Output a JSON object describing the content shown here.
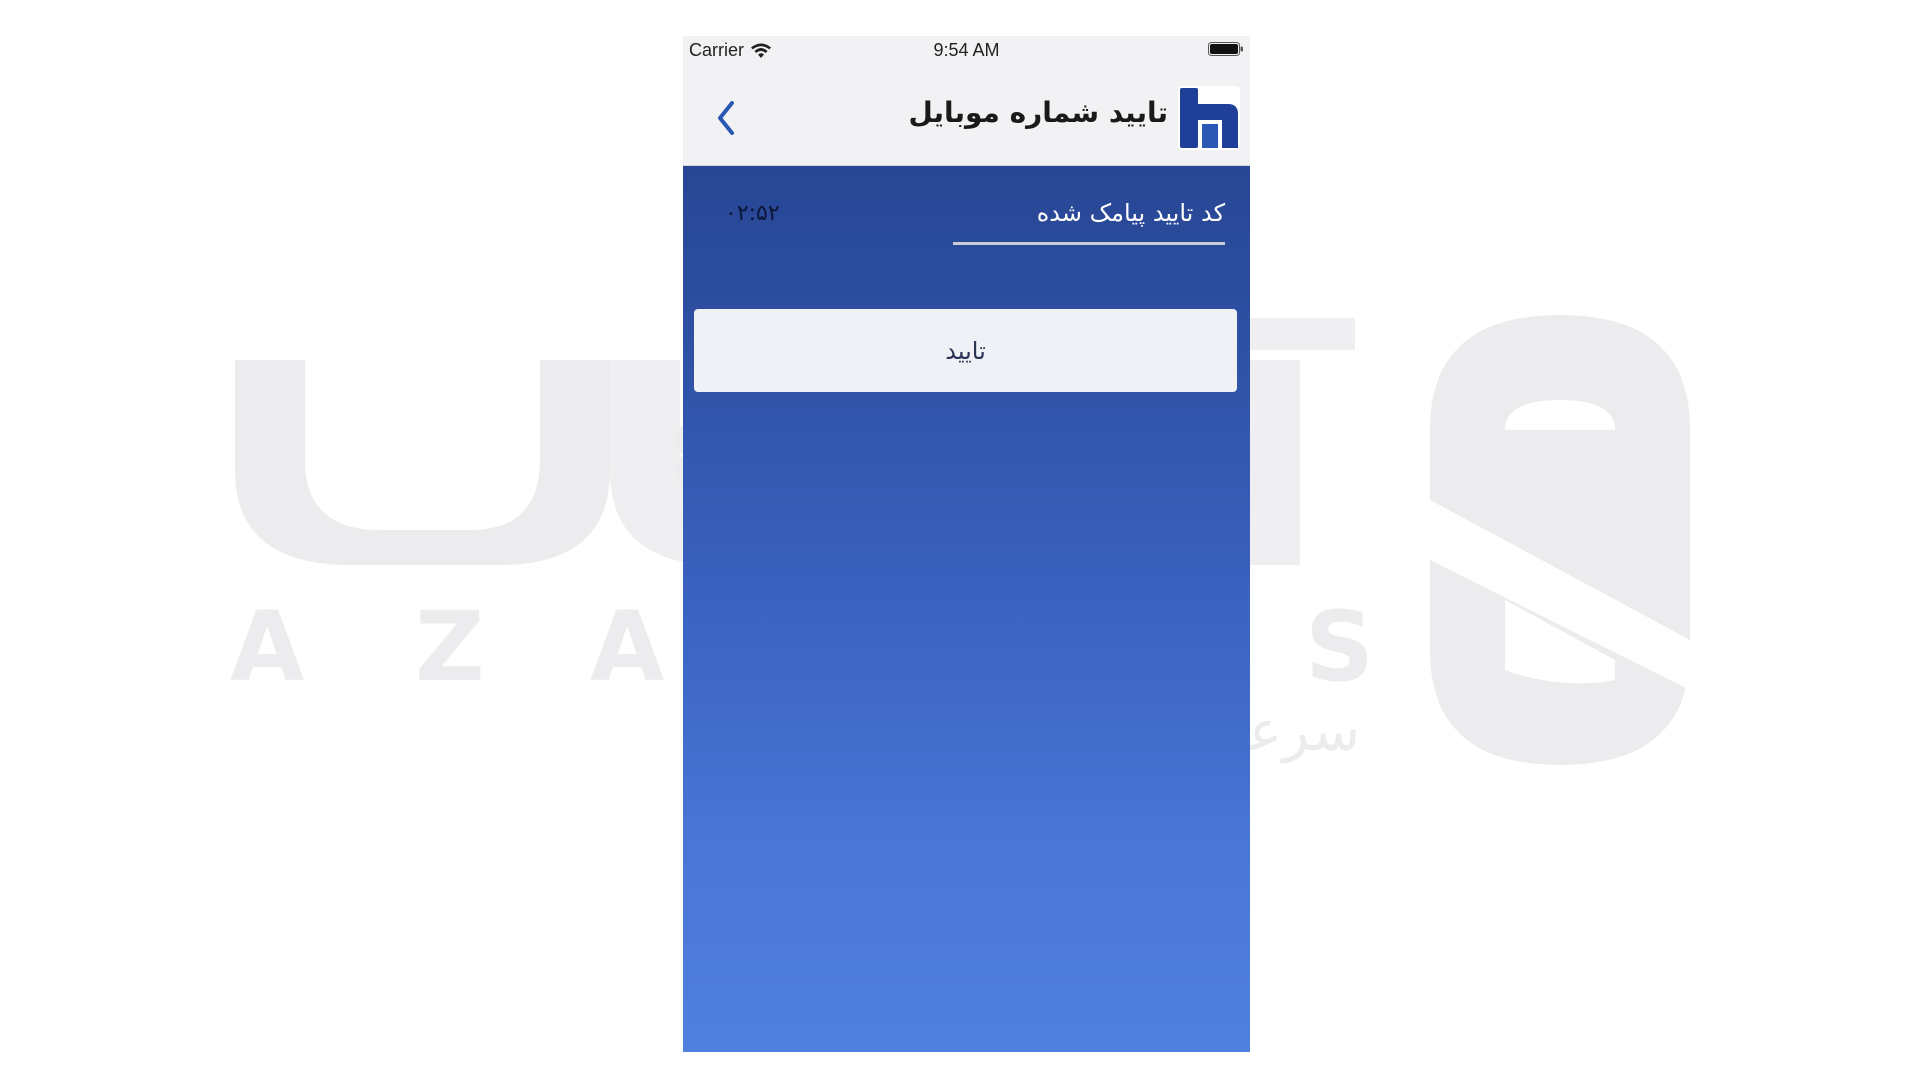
{
  "status_bar": {
    "carrier": "Carrier",
    "time": "9:54 AM"
  },
  "nav_bar": {
    "title": "تایید شماره موبایل",
    "back_icon": "chevron-left-icon",
    "logo_icon": "bank-saderat-logo"
  },
  "form": {
    "code_label": "کد تایید پیامک شده",
    "code_value": "",
    "timer": "۰۲:۵۲",
    "confirm_label": "تایید"
  },
  "watermark": {
    "brand_latin": "AZARSYS",
    "brand_persian": "آذرسیس",
    "slogan": "سرعت بی نهایت میزبانی وب"
  },
  "colors": {
    "accent": "#2b57b5",
    "gradient_top": "#233f8a",
    "gradient_bottom": "#5180de",
    "nav_background": "#f2f2f4",
    "button_background": "#f7f7f9",
    "watermark": "#e9e9ec"
  }
}
